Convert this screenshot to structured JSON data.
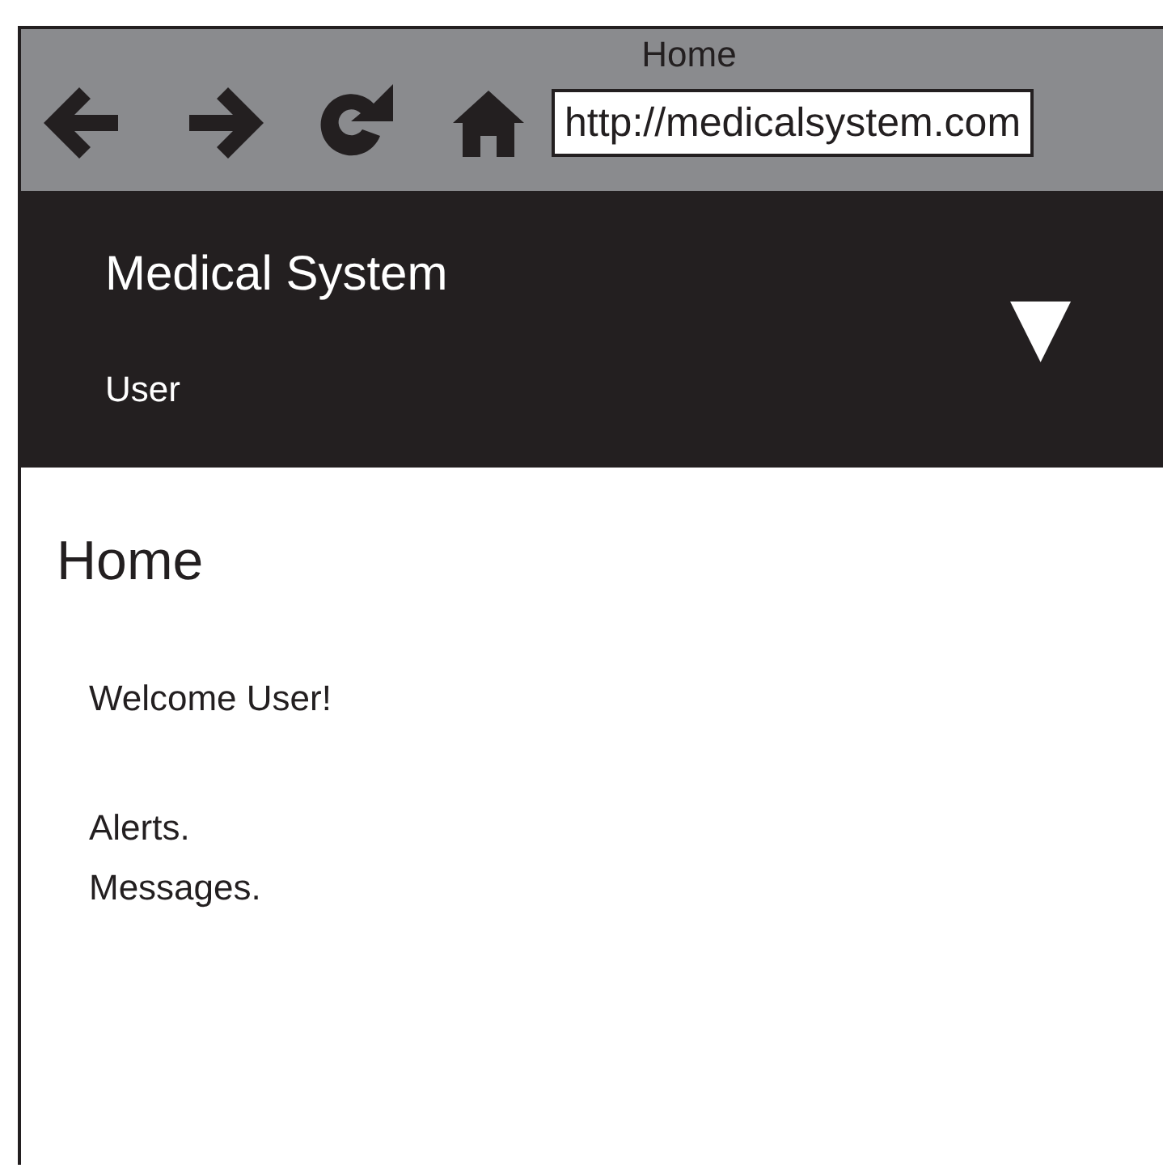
{
  "browser": {
    "title": "Home",
    "url": "http://medicalsystem.com"
  },
  "header": {
    "app_name": "Medical System",
    "user": "User",
    "menu": "▼"
  },
  "page": {
    "heading": "Home",
    "welcome": "Welcome User!",
    "lines": [
      "Alerts.",
      "Messages."
    ]
  }
}
